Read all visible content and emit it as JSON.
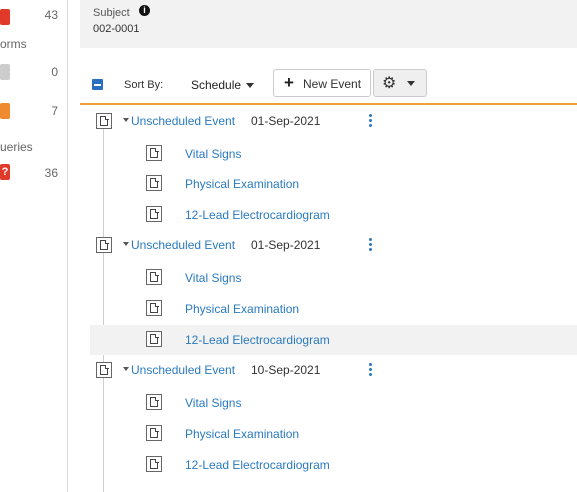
{
  "left_panel": {
    "items": [
      {
        "count": "43",
        "label": "orms",
        "color": "#e23a2a",
        "glyph": ""
      },
      {
        "count": "0",
        "label": "",
        "color": "#cccccc",
        "glyph": ""
      },
      {
        "count": "7",
        "label": "",
        "color": "#f08a30",
        "glyph": ""
      },
      {
        "count": "36",
        "label": "ueries",
        "color": "#e23a2a",
        "glyph": "?"
      }
    ]
  },
  "subject": {
    "label": "Subject",
    "info_icon": "info-circle-icon",
    "id": "002-0001"
  },
  "toolbar": {
    "sort_by_label": "Sort By:",
    "sort_by_value": "Schedule",
    "new_event_label": "New Event",
    "new_event_icon": "plus-icon",
    "settings_icon": "gear-icon",
    "accent_color": "#f0a030"
  },
  "events": [
    {
      "name": "Unscheduled Event",
      "date": "01-Sep-2021",
      "forms": [
        "Vital Signs",
        "Physical Examination",
        "12-Lead Electrocardiogram"
      ]
    },
    {
      "name": "Unscheduled Event",
      "date": "01-Sep-2021",
      "forms": [
        "Vital Signs",
        "Physical Examination",
        "12-Lead Electrocardiogram"
      ]
    },
    {
      "name": "Unscheduled Event",
      "date": "10-Sep-2021",
      "forms": [
        "Vital Signs",
        "Physical Examination",
        "12-Lead Electrocardiogram"
      ]
    }
  ]
}
